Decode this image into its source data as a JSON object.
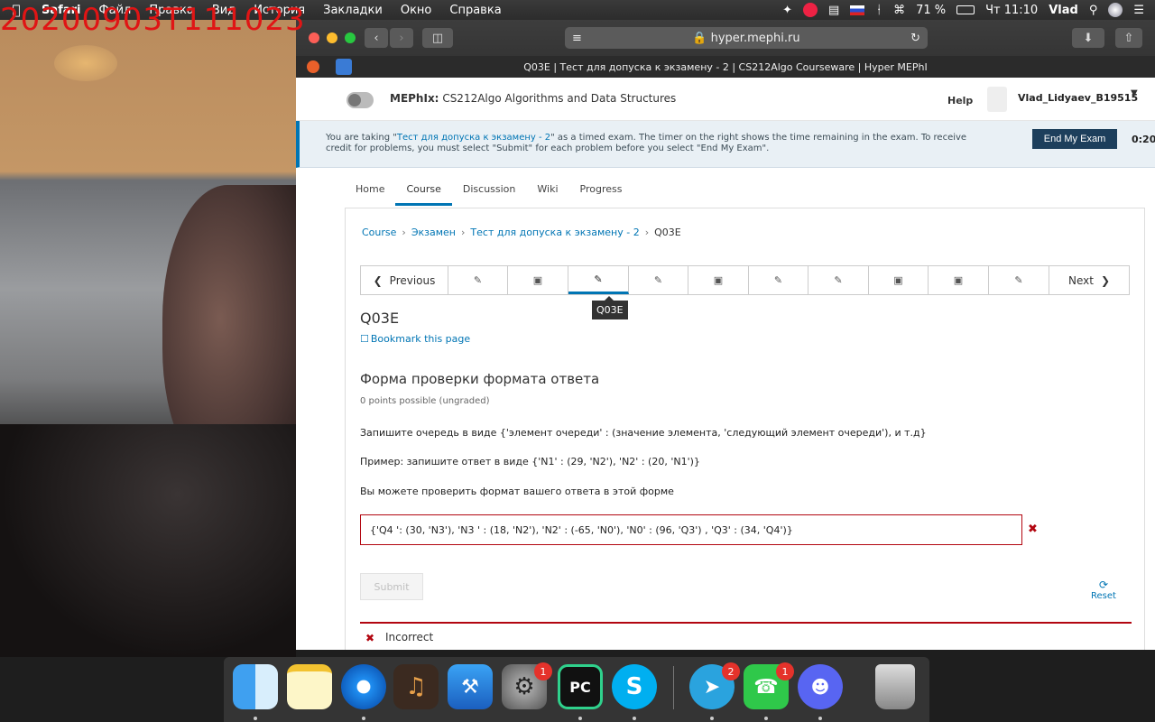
{
  "recording_timestamp": "20200903T111023",
  "menubar": {
    "app_name": "Safari",
    "items": [
      "Файл",
      "Правка",
      "Вид",
      "История",
      "Закладки",
      "Окно",
      "Справка"
    ],
    "battery": "71 %",
    "time": "Чт 11:10",
    "user": "Vlad"
  },
  "browser": {
    "url": "hyper.mephi.ru",
    "tab_title": "Q03E | Тест для допуска к экзамену - 2 | CS212Algo Courseware | Hyper MEPhI"
  },
  "header": {
    "org": "MEPhIx:",
    "course": "CS212Algo Algorithms and Data Structures",
    "help": "Help",
    "username": "Vlad_Lidyaev_B19515"
  },
  "exam_banner": {
    "text_before": "You are taking \"",
    "exam_link": "Тест для допуска к экзамену - 2",
    "text_after": "\" as a timed exam. The timer on the right shows the time remaining in the exam. To receive credit for problems, you must select \"Submit\" for each problem before you select \"End My Exam\".",
    "end_button": "End My Exam",
    "timer": "0:20:"
  },
  "course_tabs": [
    "Home",
    "Course",
    "Discussion",
    "Wiki",
    "Progress"
  ],
  "breadcrumb": {
    "course": "Course",
    "section": "Экзамен",
    "subsection": "Тест для допуска к экзамену - 2",
    "current": "Q03E"
  },
  "sequence": {
    "previous": "Previous",
    "next": "Next",
    "tooltip": "Q03E"
  },
  "unit": {
    "title": "Q03E",
    "bookmark": "Bookmark this page"
  },
  "problem": {
    "title": "Форма проверки формата ответа",
    "points": "0 points possible (ungraded)",
    "instruction": "Запишите очередь в виде {'элемент очереди' : (значение элемента, 'следующий элемент очереди'), и т.д}",
    "example": "Пример: запишите ответ в виде {'N1' : (29, 'N2'), 'N2' : (20, 'N1')}",
    "check_note": "Вы можете проверить формат вашего ответа в этой форме",
    "answer_value": "{'Q4 ': (30, 'N3'), 'N3 ' : (18, 'N2'), 'N2' : (-65, 'N0'), 'N0' : (96, 'Q3') , 'Q3' : (34, 'Q4')}",
    "submit": "Submit",
    "reset": "Reset",
    "feedback": "Incorrect"
  },
  "dock": {
    "apps": [
      "Finder",
      "Notes",
      "Safari",
      "GarageBand",
      "Xcode",
      "System Preferences",
      "PyCharm",
      "Skype",
      "Telegram",
      "FaceTime",
      "Discord",
      "Trash"
    ],
    "badges": {
      "system_preferences": "1",
      "telegram": "2",
      "facetime": "1"
    }
  }
}
